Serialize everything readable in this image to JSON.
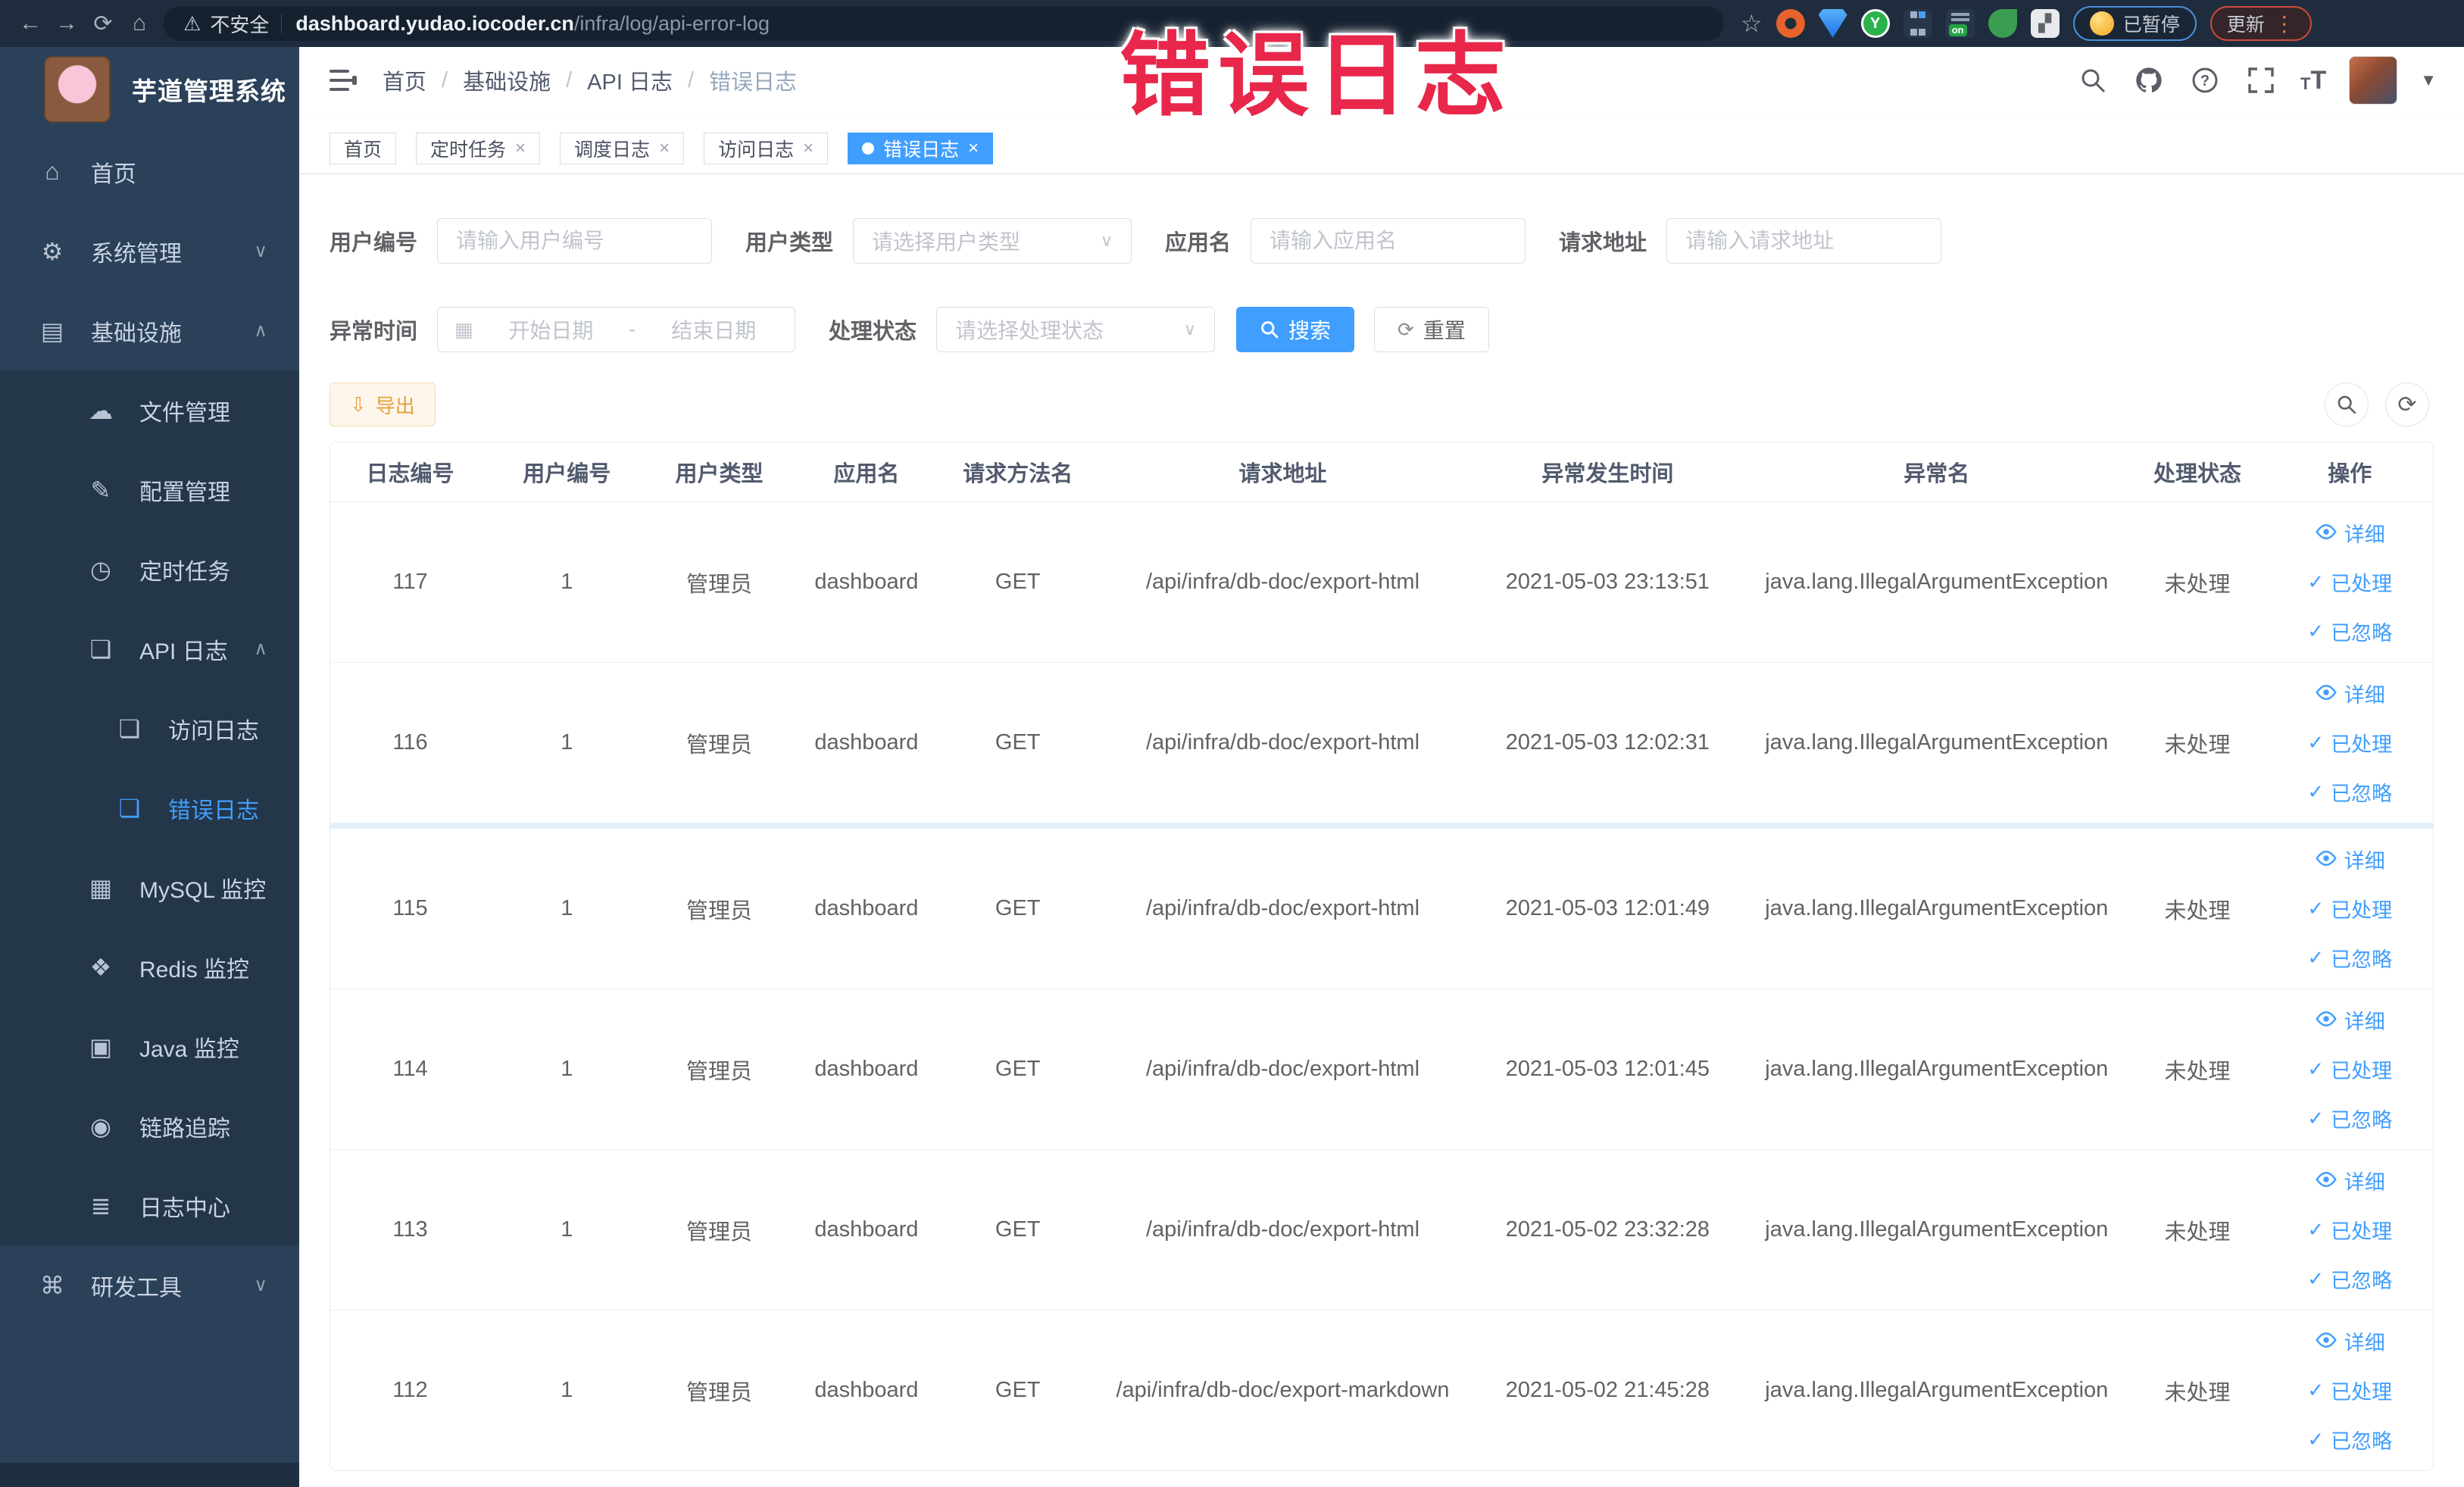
{
  "browser": {
    "security_label": "不安全",
    "url_host": "dashboard.yudao.iocoder.cn",
    "url_path": "/infra/log/api-error-log",
    "paused_badge": "已暂停",
    "update_button": "更新"
  },
  "watermark": "错误日志",
  "colors": {
    "accent": "#409eff",
    "watermark_red": "#e8274b",
    "export_orange": "#e6a23c",
    "sidebar_bg": "#2b4059",
    "sidebar_submenu_bg": "#243649",
    "active_tab_bg": "#409eff"
  },
  "sidebar": {
    "logo_title": "芋道管理系统",
    "items": [
      {
        "name": "home",
        "label": "首页",
        "icon": "home-icon",
        "level": 1
      },
      {
        "name": "system-management",
        "label": "系统管理",
        "icon": "gear-icon",
        "level": 1,
        "chevron": "down"
      },
      {
        "name": "infrastructure",
        "label": "基础设施",
        "icon": "infra-icon",
        "level": 1,
        "chevron": "up"
      },
      {
        "name": "file-management",
        "label": "文件管理",
        "icon": "file-upload-icon",
        "level": 2
      },
      {
        "name": "config-management",
        "label": "配置管理",
        "icon": "edit-icon",
        "level": 2
      },
      {
        "name": "scheduled-tasks",
        "label": "定时任务",
        "icon": "timer-icon",
        "level": 2
      },
      {
        "name": "api-log",
        "label": "API 日志",
        "icon": "document-icon",
        "level": 2,
        "chevron": "up"
      },
      {
        "name": "access-log",
        "label": "访问日志",
        "icon": "document-icon",
        "level": 3
      },
      {
        "name": "error-log",
        "label": "错误日志",
        "icon": "document-icon",
        "level": 3,
        "active": true
      },
      {
        "name": "mysql-monitor",
        "label": "MySQL 监控",
        "icon": "mysql-icon",
        "level": 2
      },
      {
        "name": "redis-monitor",
        "label": "Redis 监控",
        "icon": "redis-icon",
        "level": 2
      },
      {
        "name": "java-monitor",
        "label": "Java 监控",
        "icon": "java-icon",
        "level": 2
      },
      {
        "name": "trace",
        "label": "链路追踪",
        "icon": "trace-eye-icon",
        "level": 2
      },
      {
        "name": "log-center",
        "label": "日志中心",
        "icon": "log-center-icon",
        "level": 2
      },
      {
        "name": "dev-tools",
        "label": "研发工具",
        "icon": "devtools-icon",
        "level": 1,
        "chevron": "down"
      }
    ]
  },
  "breadcrumb": {
    "items": [
      "首页",
      "基础设施",
      "API 日志",
      "错误日志"
    ]
  },
  "tabs": [
    {
      "label": "首页",
      "closable": false,
      "active": false
    },
    {
      "label": "定时任务",
      "closable": true,
      "active": false
    },
    {
      "label": "调度日志",
      "closable": true,
      "active": false
    },
    {
      "label": "访问日志",
      "closable": true,
      "active": false
    },
    {
      "label": "错误日志",
      "closable": true,
      "active": true
    }
  ],
  "filters": {
    "row1": [
      {
        "label": "用户编号",
        "placeholder": "请输入用户编号",
        "type": "input"
      },
      {
        "label": "用户类型",
        "placeholder": "请选择用户类型",
        "type": "select"
      },
      {
        "label": "应用名",
        "placeholder": "请输入应用名",
        "type": "input"
      },
      {
        "label": "请求地址",
        "placeholder": "请输入请求地址",
        "type": "input"
      }
    ],
    "row2": [
      {
        "label": "异常时间",
        "type": "daterange",
        "start_placeholder": "开始日期",
        "separator": "-",
        "end_placeholder": "结束日期"
      },
      {
        "label": "处理状态",
        "placeholder": "请选择处理状态",
        "type": "select"
      }
    ],
    "search_label": "搜索",
    "reset_label": "重置"
  },
  "toolbar": {
    "export_label": "导出"
  },
  "table": {
    "columns": [
      "日志编号",
      "用户编号",
      "用户类型",
      "应用名",
      "请求方法名",
      "请求地址",
      "异常发生时间",
      "异常名",
      "处理状态",
      "操作"
    ],
    "row_actions": [
      {
        "label": "详细",
        "icon": "eye-icon"
      },
      {
        "label": "已处理",
        "icon": "check-icon"
      },
      {
        "label": "已忽略",
        "icon": "check-icon"
      }
    ],
    "rows": [
      {
        "id": "117",
        "user_id": "1",
        "user_type": "管理员",
        "app_name": "dashboard",
        "method": "GET",
        "url": "/api/infra/db-doc/export-html",
        "time": "2021-05-03 23:13:51",
        "exception": "java.lang.IllegalArgumentException",
        "status": "未处理"
      },
      {
        "id": "116",
        "user_id": "1",
        "user_type": "管理员",
        "app_name": "dashboard",
        "method": "GET",
        "url": "/api/infra/db-doc/export-html",
        "time": "2021-05-03 12:02:31",
        "exception": "java.lang.IllegalArgumentException",
        "status": "未处理"
      },
      {
        "id": "115",
        "user_id": "1",
        "user_type": "管理员",
        "app_name": "dashboard",
        "method": "GET",
        "url": "/api/infra/db-doc/export-html",
        "time": "2021-05-03 12:01:49",
        "exception": "java.lang.IllegalArgumentException",
        "status": "未处理"
      },
      {
        "id": "114",
        "user_id": "1",
        "user_type": "管理员",
        "app_name": "dashboard",
        "method": "GET",
        "url": "/api/infra/db-doc/export-html",
        "time": "2021-05-03 12:01:45",
        "exception": "java.lang.IllegalArgumentException",
        "status": "未处理"
      },
      {
        "id": "113",
        "user_id": "1",
        "user_type": "管理员",
        "app_name": "dashboard",
        "method": "GET",
        "url": "/api/infra/db-doc/export-html",
        "time": "2021-05-02 23:32:28",
        "exception": "java.lang.IllegalArgumentException",
        "status": "未处理"
      },
      {
        "id": "112",
        "user_id": "1",
        "user_type": "管理员",
        "app_name": "dashboard",
        "method": "GET",
        "url": "/api/infra/db-doc/export-markdown",
        "time": "2021-05-02 21:45:28",
        "exception": "java.lang.IllegalArgumentException",
        "status": "未处理"
      }
    ]
  }
}
